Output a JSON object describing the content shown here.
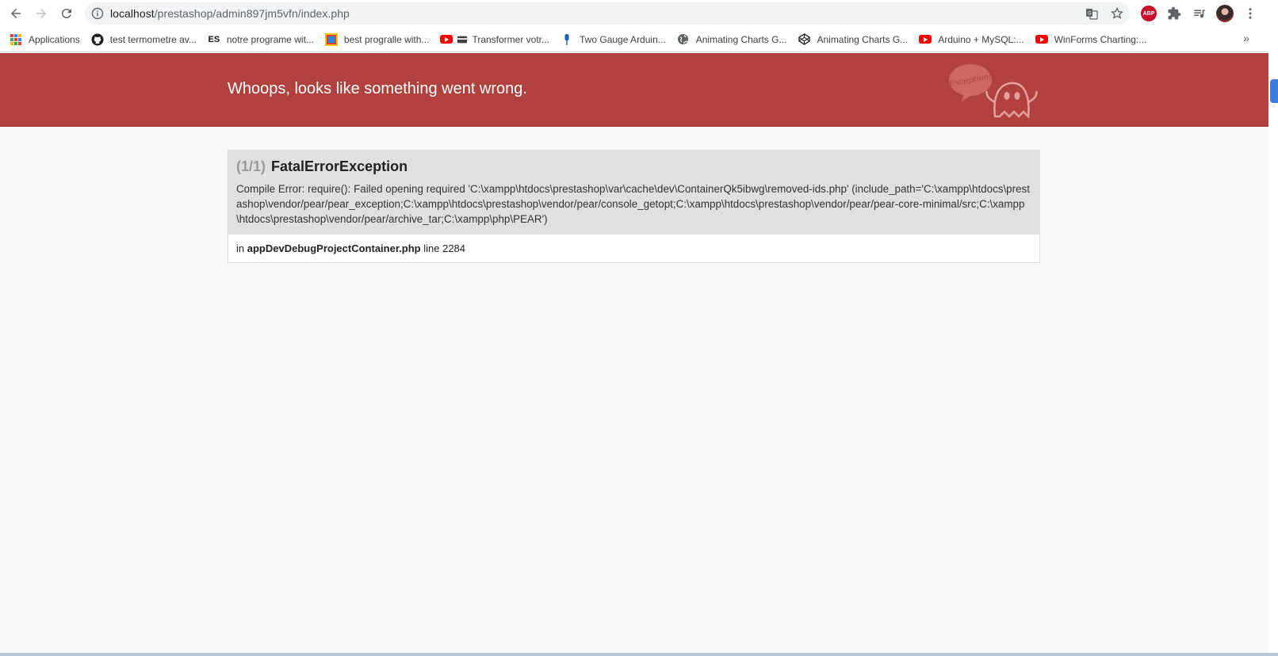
{
  "browser": {
    "url_host": "localhost",
    "url_path": "/prestashop/admin897jm5vfn/index.php",
    "abp_label": "ABP"
  },
  "bookmarks": [
    {
      "label": "Applications",
      "icon": "apps-grid-icon"
    },
    {
      "label": "test termometre av...",
      "icon": "github-icon"
    },
    {
      "label": "notre programe wit...",
      "icon": "es-icon"
    },
    {
      "label": "best progгаlle with...",
      "icon": "site-favicon-icon"
    },
    {
      "label": "Transformer votr...",
      "icon": "youtube-icon"
    },
    {
      "label": "Two Gauge Arduin...",
      "icon": "pin-icon"
    },
    {
      "label": "Animating Charts G...",
      "icon": "globe-icon"
    },
    {
      "label": "Animating Charts G...",
      "icon": "codepen-icon"
    },
    {
      "label": "Arduino + MySQL:...",
      "icon": "youtube-icon"
    },
    {
      "label": "WinForms Charting:...",
      "icon": "youtube-icon"
    }
  ],
  "bookmarks_more": "»",
  "error_page": {
    "header_title": "Whoops, looks like something went wrong.",
    "ghost_label": "Exception!",
    "exception": {
      "count": "(1/1)",
      "name": "FatalErrorException",
      "message": "Compile Error: require(): Failed opening required 'C:\\xampp\\htdocs\\prestashop\\var\\cache\\dev\\ContainerQk5ibwg\\removed-ids.php' (include_path='C:\\xampp\\htdocs\\prestashop\\vendor/pear/pear_exception;C:\\xampp\\htdocs\\prestashop\\vendor/pear/console_getopt;C:\\xampp\\htdocs\\prestashop\\vendor/pear/pear-core-minimal/src;C:\\xampp\\htdocs\\prestashop\\vendor/pear/archive_tar;C:\\xampp\\php\\PEAR')",
      "location_prefix": "in",
      "file": "appDevDebugProjectContainer.php",
      "line_label": "line 2284"
    }
  },
  "colors": {
    "header_bg": "#b0413e",
    "exception_head_bg": "#e0e0e0"
  }
}
